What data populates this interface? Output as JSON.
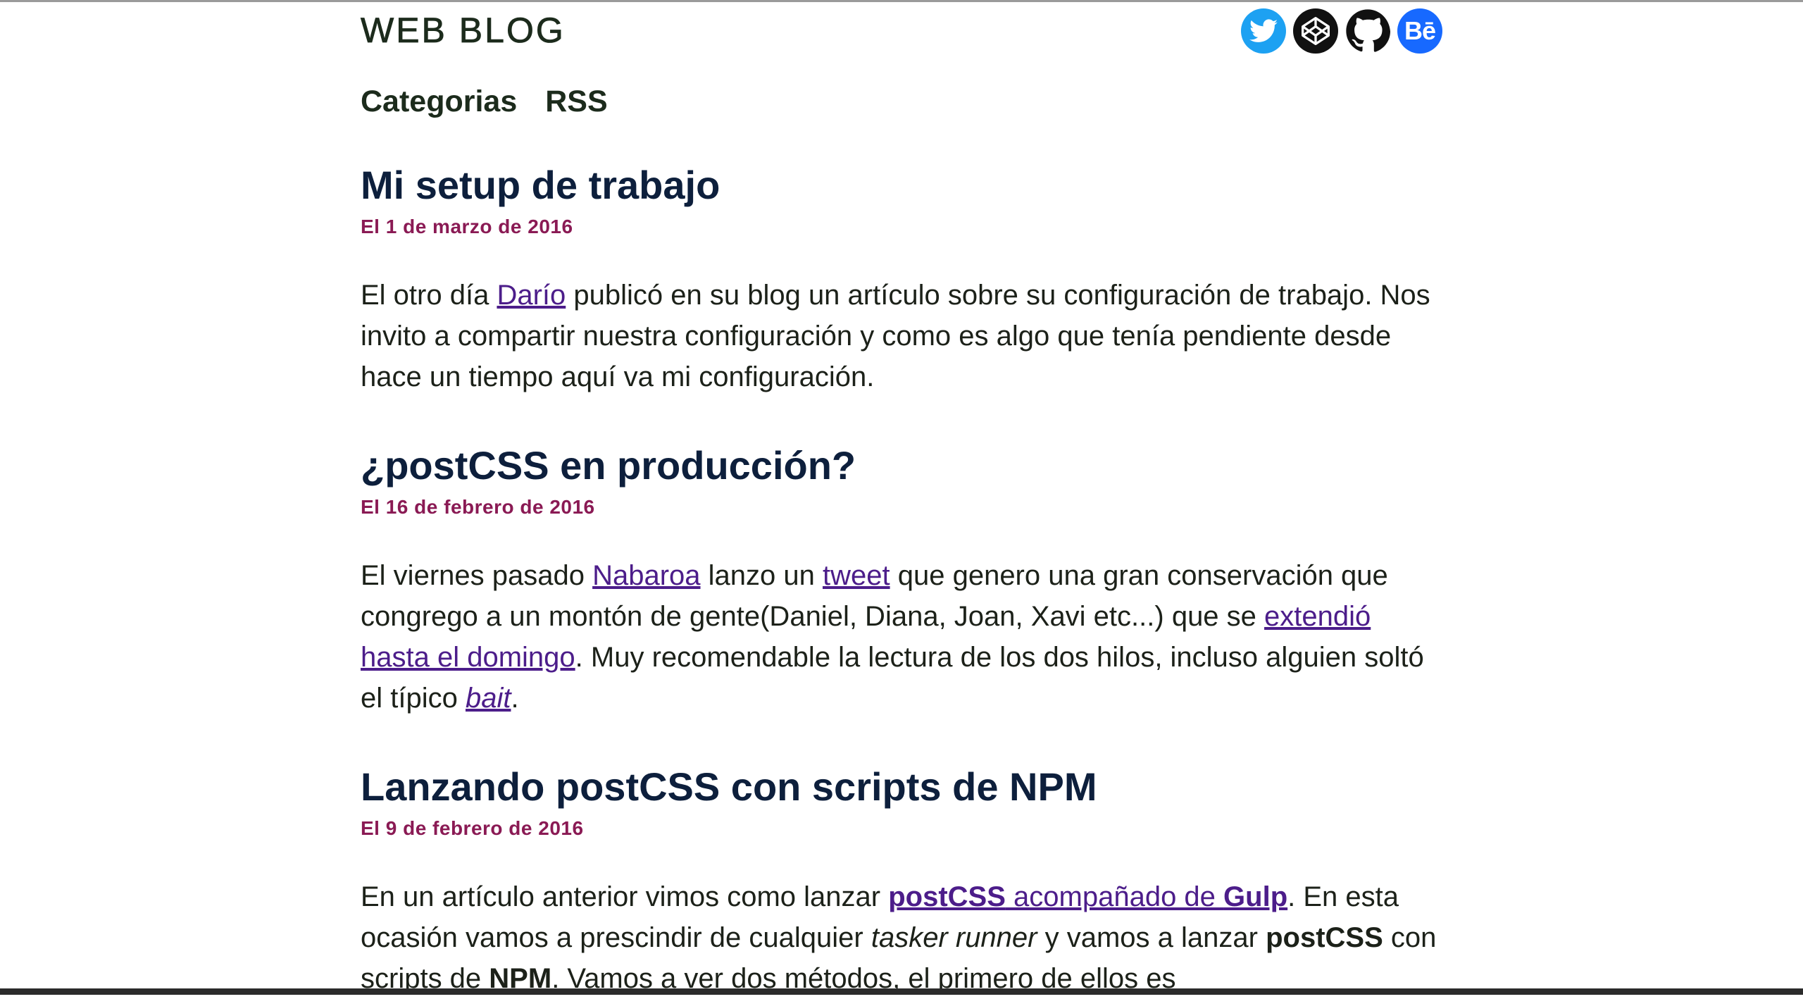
{
  "header": {
    "title": "WEB BLOG",
    "social": [
      {
        "icon": "twitter-icon",
        "color": "#1da1f2"
      },
      {
        "icon": "codepen-icon",
        "color": "#111111"
      },
      {
        "icon": "github-icon",
        "color": "#111111"
      },
      {
        "icon": "behance-icon",
        "color": "#1769ff",
        "text": "Bē"
      }
    ]
  },
  "nav": {
    "categories": "Categorias",
    "rss": "RSS"
  },
  "posts": [
    {
      "title": "Mi setup de trabajo",
      "date": "El 1 de marzo de 2016",
      "body": {
        "t1": "El otro día ",
        "link1": "Darío",
        "t2": " publicó en su blog un artículo sobre su configuración de trabajo. Nos invito a compartir nuestra configuración y como es algo que tenía pendiente desde hace un tiempo aquí va mi configuración."
      }
    },
    {
      "title": "¿postCSS en producción?",
      "date": "El 16 de febrero de 2016",
      "body": {
        "t1": "El viernes pasado ",
        "link1": "Nabaroa",
        "t2": " lanzo un ",
        "link2": "tweet",
        "t3": " que genero una gran conservación que congrego a un montón de gente(Daniel, Diana, Joan, Xavi etc...) que se ",
        "link3": "extendió hasta el domingo",
        "t4": ". Muy recomendable la lectura de los dos hilos, incluso alguien soltó el típico ",
        "link4": "bait",
        "t5": "."
      }
    },
    {
      "title": "Lanzando postCSS con scripts de NPM",
      "date": "El 9 de febrero de 2016",
      "body": {
        "t1": "En un artículo anterior vimos como lanzar ",
        "link1_b1": "postCSS",
        "link1_mid": " acompañado de ",
        "link1_b2": "Gulp",
        "t2": ". En esta ocasión vamos a prescindir de cualquier ",
        "em1": "tasker runner",
        "t3": " y vamos a lanzar ",
        "b1": "postCSS",
        "t4": " con scripts de ",
        "b2": "NPM",
        "t5": ". Vamos a ver dos métodos, el primero de ellos es"
      }
    }
  ],
  "colors": {
    "title_color": "#0d1f3c",
    "date_color": "#8a1a54",
    "link_color": "#4c1d8a"
  }
}
